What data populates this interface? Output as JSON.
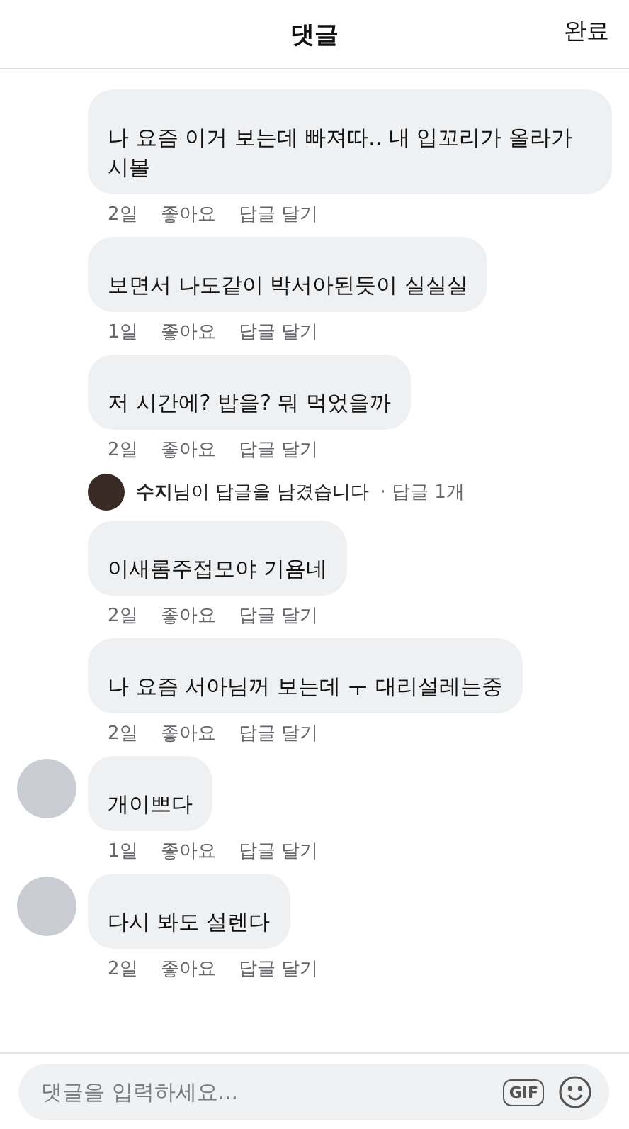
{
  "header": {
    "title": "댓글",
    "done": "완료"
  },
  "comments": [
    {
      "text": "나 요즘 이거 보는데 빠져따.. 내 입꼬리가 올라가 시볼",
      "time": "2일",
      "like": "좋아요",
      "reply": "답글 달기",
      "avatar_shown": false
    },
    {
      "text": "보면서 나도같이 박서아된듯이 실실실",
      "time": "1일",
      "like": "좋아요",
      "reply": "답글 달기",
      "avatar_shown": false
    },
    {
      "text": "저 시간에? 밥을? 뭐 먹었을까",
      "time": "2일",
      "like": "좋아요",
      "reply": "답글 달기",
      "avatar_shown": false,
      "reply_summary": {
        "text": "**수지**님이 답글을 남겼습니다",
        "count": "· 답글 1개"
      }
    },
    {
      "text": "이새롬주접모야 기욤네",
      "time": "2일",
      "like": "좋아요",
      "reply": "답글 달기",
      "avatar_shown": false
    },
    {
      "text": "나 요즘 서아님꺼 보는데 ㅜ 대리설레는중",
      "time": "2일",
      "like": "좋아요",
      "reply": "답글 달기",
      "avatar_shown": false
    },
    {
      "text": "개이쁘다",
      "time": "1일",
      "like": "좋아요",
      "reply": "답글 달기",
      "avatar_shown": true
    },
    {
      "text": "다시 봐도 설렌다",
      "time": "2일",
      "like": "좋아요",
      "reply": "답글 달기",
      "avatar_shown": true
    }
  ],
  "composer": {
    "placeholder": "댓글을 입력하세요...",
    "gif": "GIF"
  }
}
